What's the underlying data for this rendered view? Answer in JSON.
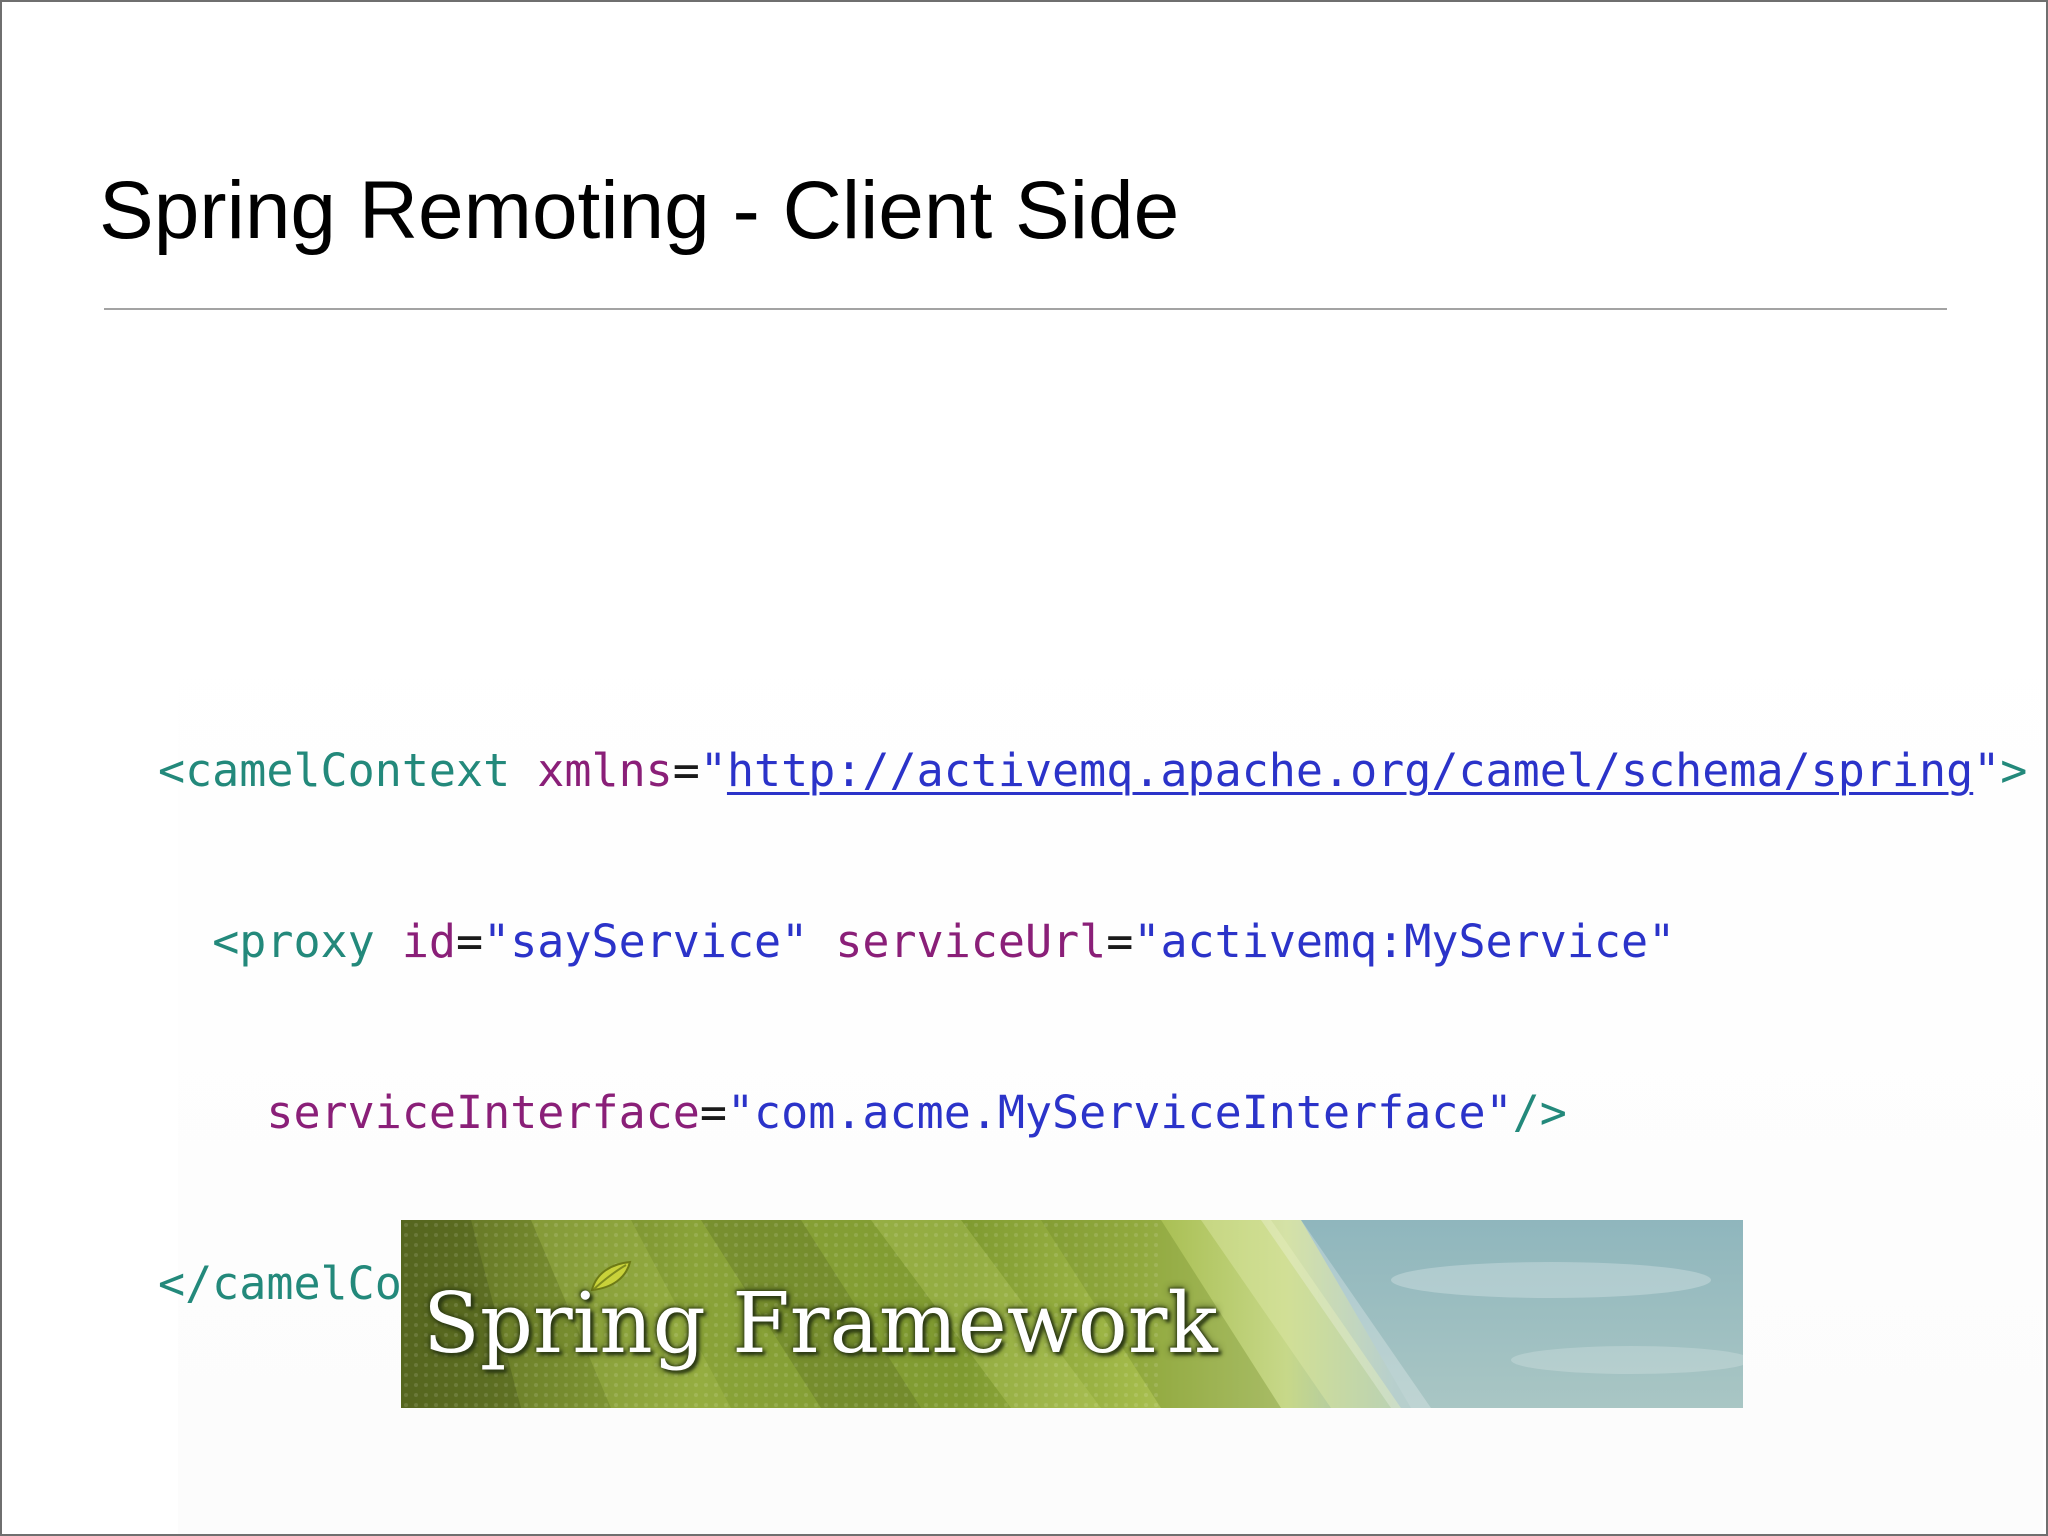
{
  "slide": {
    "title": "Spring Remoting - Client Side"
  },
  "code": {
    "line1": {
      "open": "<",
      "tag": "camelContext",
      "attr": "xmlns",
      "eq": "=",
      "q1": "\"",
      "url": "http://activemq.apache.org/camel/schema/spring",
      "q2": "\"",
      "close": ">"
    },
    "line2": {
      "open": "<",
      "tag": "proxy",
      "attr1": "id",
      "eq1": "=",
      "val1": "\"sayService\"",
      "attr2": "serviceUrl",
      "eq2": "=",
      "val2": "\"activemq:MyService\""
    },
    "line3": {
      "attr": "serviceInterface",
      "eq": "=",
      "val": "\"com.acme.MyServiceInterface\"",
      "close": "/>"
    },
    "line4": {
      "text": "</camelContext>"
    }
  },
  "banner": {
    "text": "Spring Framework",
    "icon": "leaf-icon"
  },
  "colors": {
    "tag": "#23897b",
    "attribute": "#8a1f78",
    "value": "#2b33c9"
  }
}
